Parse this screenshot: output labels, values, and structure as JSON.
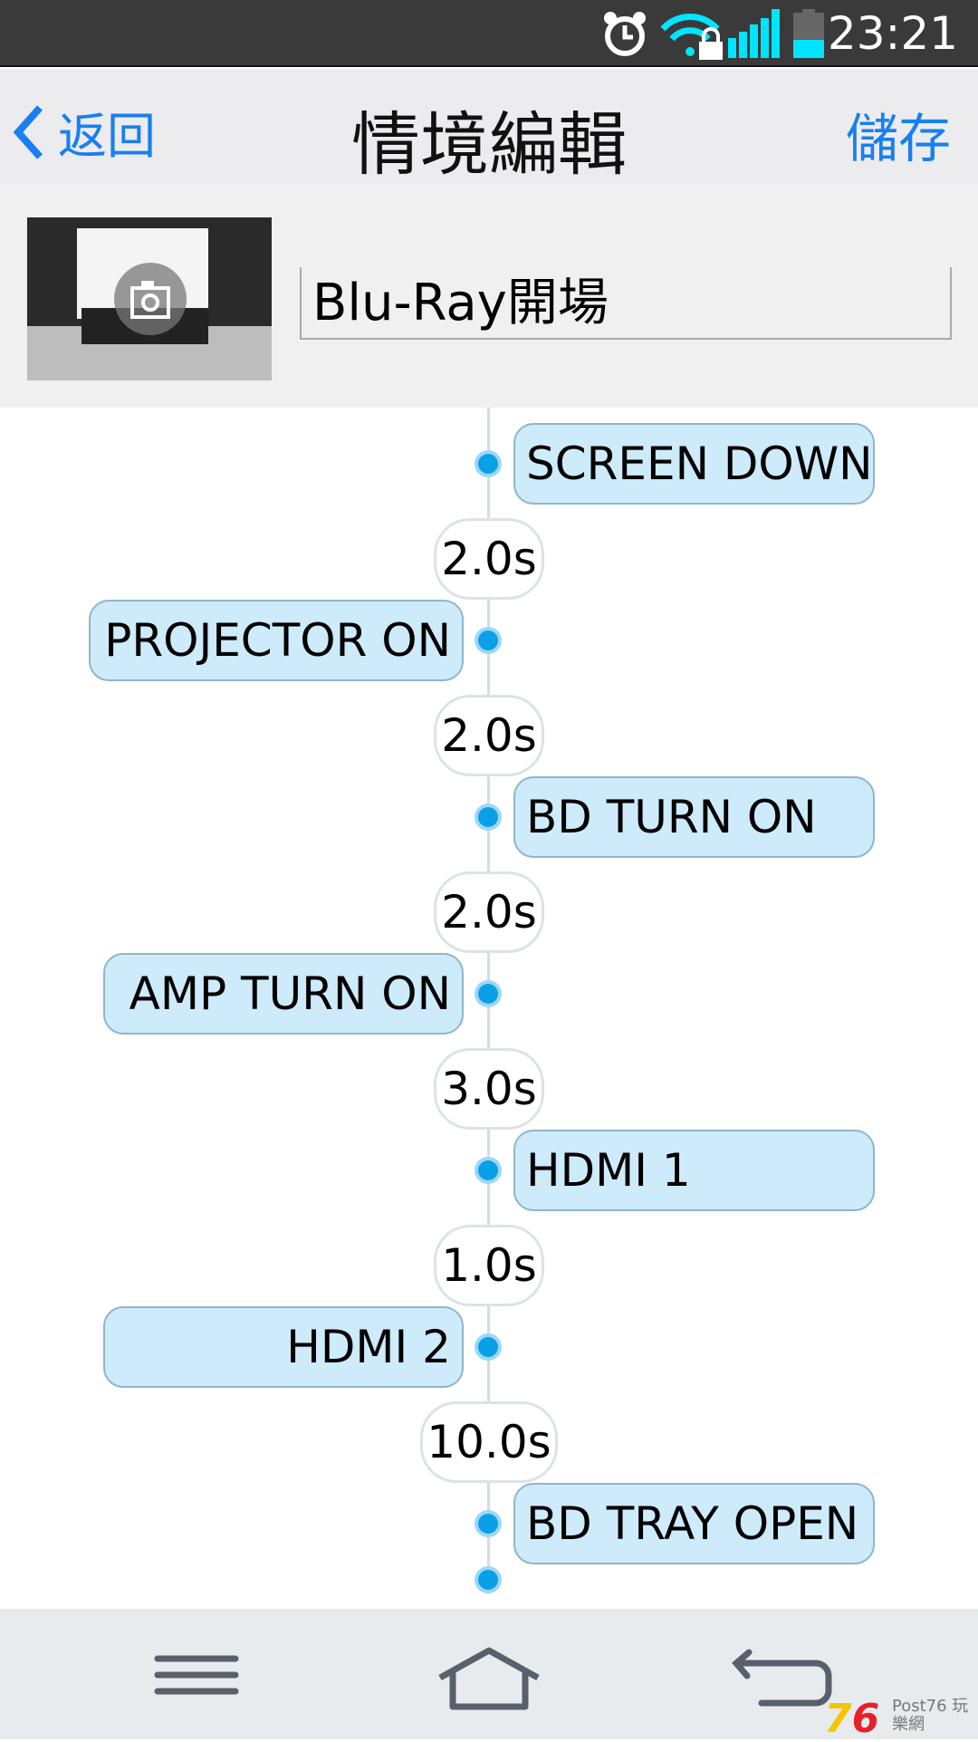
{
  "status_bar": {
    "time": "23:21",
    "icons": [
      "alarm-icon",
      "wifi-lock-icon",
      "signal-icon",
      "battery-icon"
    ],
    "battery_level": 0.4
  },
  "header": {
    "back_label": "返回",
    "title": "情境編輯",
    "save_label": "儲存"
  },
  "scene": {
    "name": "Blu-Ray開場",
    "photo_icon": "camera-icon"
  },
  "timeline": {
    "steps": [
      {
        "label": "SCREEN DOWN",
        "side": "right",
        "delay_after": "2.0s"
      },
      {
        "label": "PROJECTOR ON",
        "side": "left",
        "delay_after": "2.0s"
      },
      {
        "label": "BD TURN ON",
        "side": "right",
        "delay_after": "2.0s"
      },
      {
        "label": "AMP TURN ON",
        "side": "left",
        "delay_after": "3.0s"
      },
      {
        "label": "HDMI 1",
        "side": "right",
        "delay_after": "1.0s"
      },
      {
        "label": "HDMI 2",
        "side": "left",
        "delay_after": "10.0s"
      },
      {
        "label": "BD TRAY OPEN",
        "side": "right",
        "delay_after": null
      }
    ]
  },
  "nav": {
    "icons": [
      "menu-icon",
      "home-icon",
      "back-icon"
    ],
    "watermark": "Post76 玩樂網"
  },
  "colors": {
    "accent": "#1a7ff0",
    "box": "#cdebfb",
    "dot": "#0aa0e8"
  }
}
